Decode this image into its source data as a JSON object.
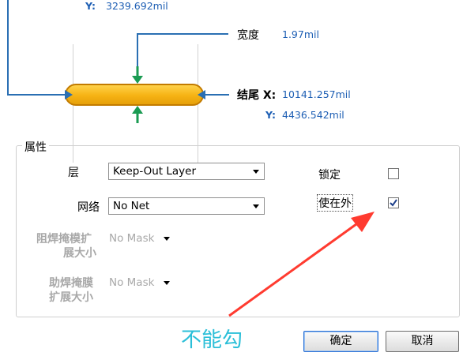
{
  "start": {
    "y_label": "Y:",
    "y_value": "3239.692mil"
  },
  "width_field": {
    "label": "宽度",
    "value": "1.97mil"
  },
  "end": {
    "label": "结尾 X:",
    "x_value": "10141.257mil",
    "y_label": "Y:",
    "y_value": "4436.542mil"
  },
  "properties": {
    "title": "属性",
    "layer_label": "层",
    "layer_value": "Keep-Out Layer",
    "net_label": "网络",
    "net_value": "No Net",
    "solder_mask_label_1": "阻焊掩模扩",
    "solder_mask_label_2": "展大小",
    "solder_mask_value": "No Mask",
    "paste_mask_label_1": "助焊掩膜",
    "paste_mask_label_2": "扩展大小",
    "paste_mask_value": "No Mask",
    "locked_label": "锁定",
    "locked_checked": false,
    "keepout_label": "使在外",
    "keepout_checked": true
  },
  "annotation": {
    "text": "不能勾",
    "color": "#2bbfd8",
    "arrow_color": "#ff3b30"
  },
  "buttons": {
    "ok_label": "确定",
    "cancel_label": "取消"
  },
  "colors": {
    "track_fill": "#f6b213",
    "track_border": "#c27b00",
    "guide_blue": "#2a6fb3",
    "dimension_green": "#1a9b52"
  }
}
